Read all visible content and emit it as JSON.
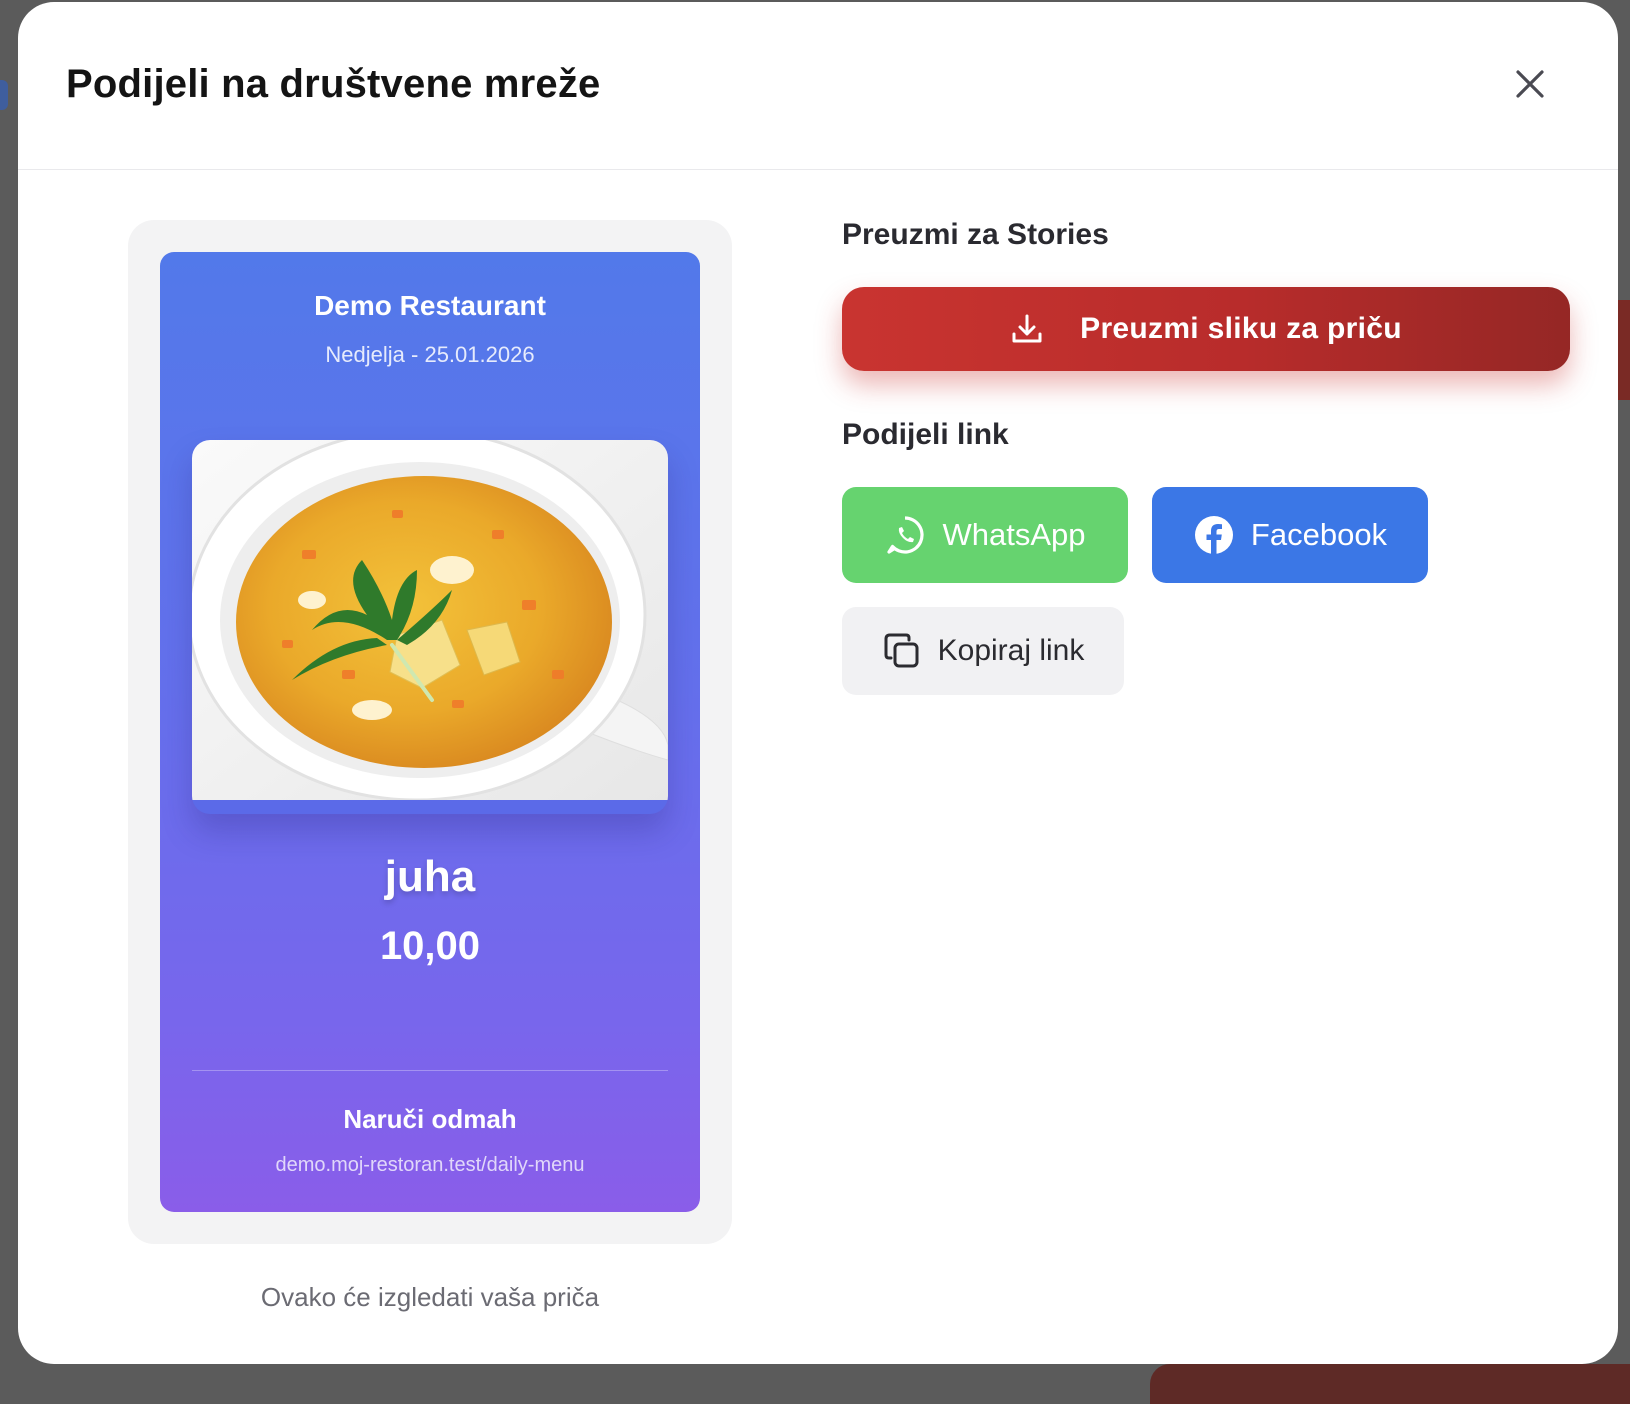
{
  "modal": {
    "title": "Podijeli na društvene mreže"
  },
  "preview": {
    "restaurant_name": "Demo Restaurant",
    "date": "Nedjelja - 25.01.2026",
    "dish_name": "juha",
    "price": "10,00",
    "cta": "Naruči odmah",
    "url": "demo.moj-restoran.test/daily-menu",
    "caption": "Ovako će izgledati vaša priča",
    "gradient_colors": [
      "#5279ea",
      "#8a5de9"
    ]
  },
  "stories": {
    "section_title": "Preuzmi za Stories",
    "download_label": "Preuzmi sliku za priču",
    "button_color": "#c93430"
  },
  "share_link": {
    "section_title": "Podijeli link",
    "whatsapp_label": "WhatsApp",
    "whatsapp_color": "#66d36f",
    "facebook_label": "Facebook",
    "facebook_color": "#3b77e6",
    "copy_label": "Kopiraj link"
  },
  "icons": {
    "close": "close-icon",
    "download": "download-icon",
    "whatsapp": "whatsapp-icon",
    "facebook": "facebook-icon",
    "copy": "copy-icon"
  }
}
